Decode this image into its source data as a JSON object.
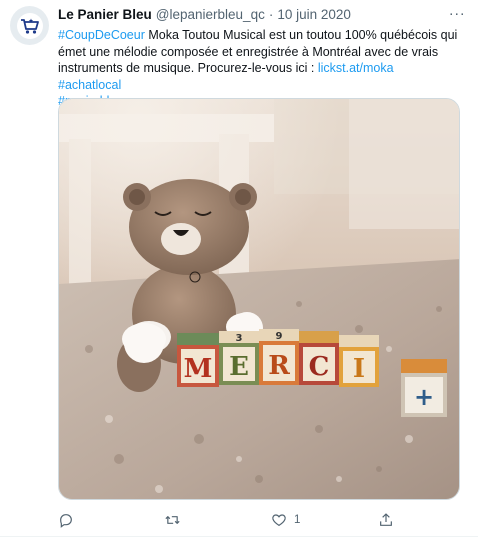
{
  "tweet": {
    "author_name": "Le Panier Bleu",
    "handle": "@lepanierbleu_qc",
    "separator": "·",
    "date": "10 juin 2020",
    "more_label": "···",
    "hashtag_1": "#CoupDeCoeur",
    "text_main": " Moka Toutou Musical est un toutou 100% québécois qui émet une mélodie composée et enregistrée à Montréal avec de vrais instruments de musique. Procurez-le-vous ici : ",
    "link": "lickst.at/moka",
    "space": " ",
    "hashtag_2": "#achatlocal",
    "hashtag_3": "#panierbleu"
  },
  "media": {
    "blocks": [
      "M",
      "E",
      "R",
      "C",
      "I",
      "+"
    ],
    "top_numbers": [
      "3",
      "9"
    ]
  },
  "actions": {
    "reply_icon": "reply-icon",
    "retweet_icon": "retweet-icon",
    "like_icon": "heart-icon",
    "like_count": "1",
    "share_icon": "share-icon"
  },
  "colors": {
    "link": "#1d9bf0",
    "text": "#0f1419",
    "secondary": "#536471",
    "brand": "#1e3a8a"
  }
}
